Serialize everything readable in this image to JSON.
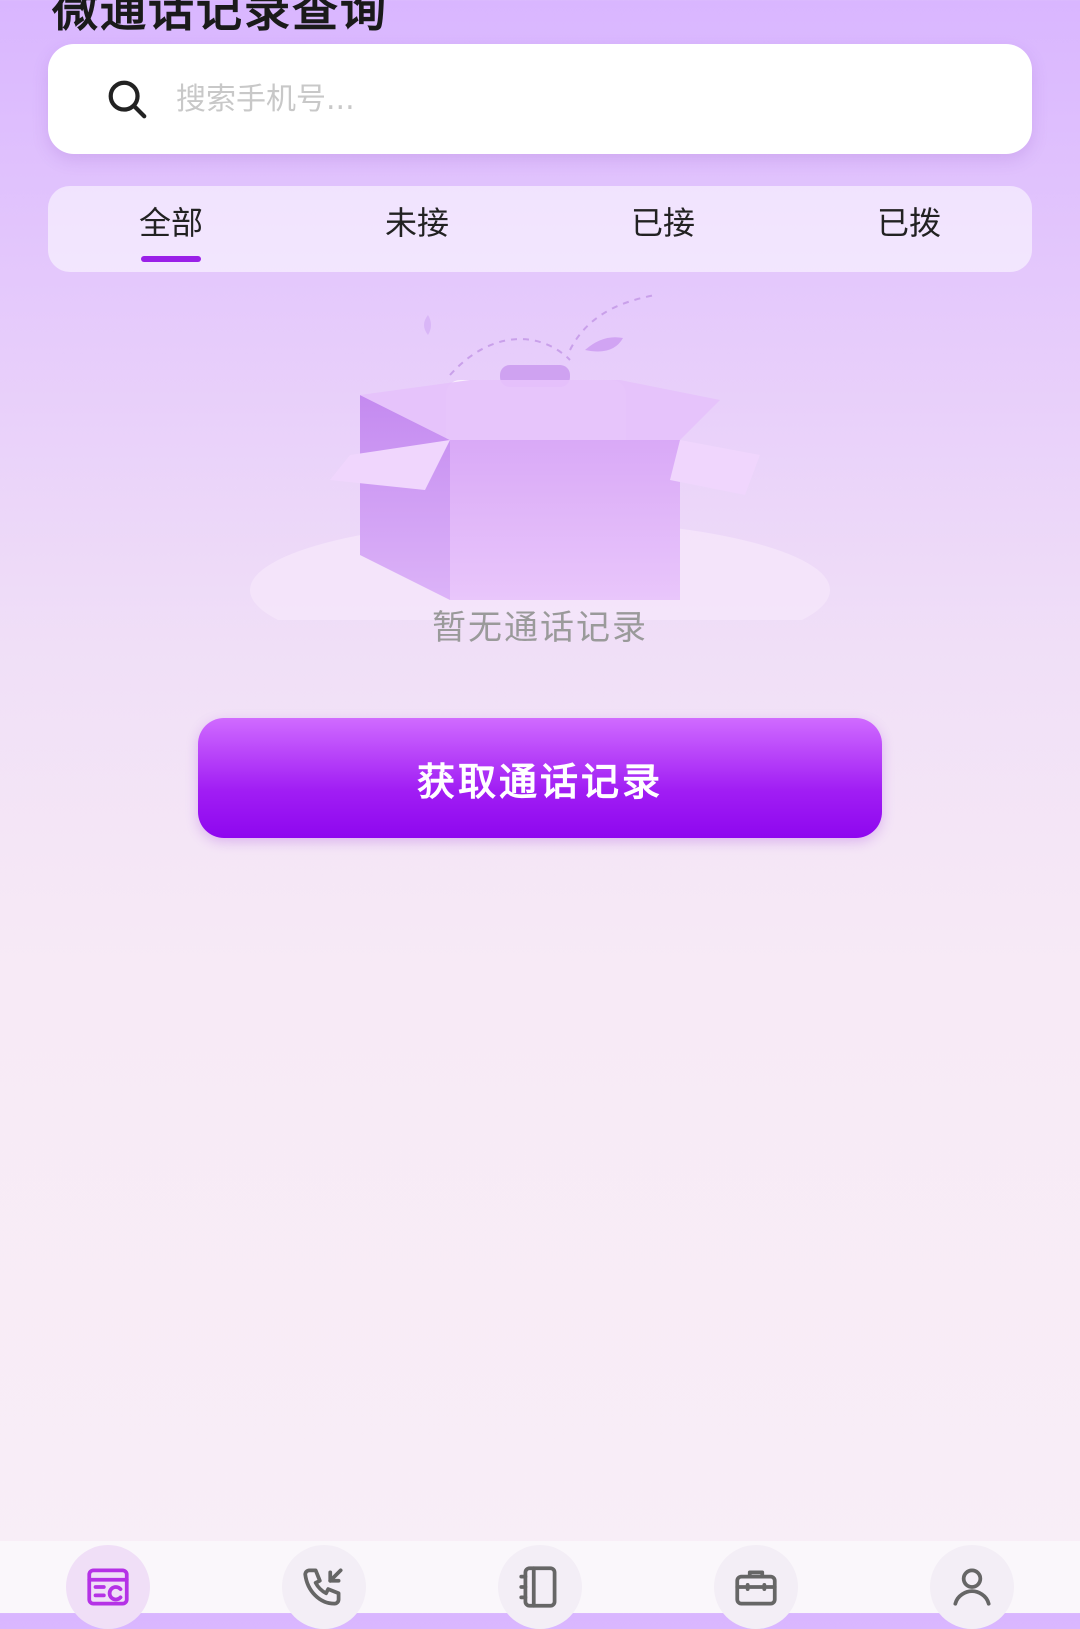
{
  "app": {
    "title": "微通话记录查询",
    "top_right_action": "···"
  },
  "search": {
    "placeholder": "搜索手机号..."
  },
  "tabs": [
    {
      "label": "全部",
      "active": true
    },
    {
      "label": "未接",
      "active": false
    },
    {
      "label": "已接",
      "active": false
    },
    {
      "label": "已拨",
      "active": false
    }
  ],
  "empty_state": {
    "message": "暂无通话记录"
  },
  "primary_action": {
    "label": "获取通话记录"
  },
  "bottom_nav": [
    {
      "icon": "call-log-icon",
      "active": true
    },
    {
      "icon": "incoming-call-icon",
      "active": false
    },
    {
      "icon": "contacts-book-icon",
      "active": false
    },
    {
      "icon": "briefcase-icon",
      "active": false
    },
    {
      "icon": "user-profile-icon",
      "active": false
    }
  ],
  "colors": {
    "accent": "#9a20e8",
    "button_top": "#d06bff",
    "button_bottom": "#8e07ef",
    "nav_active": "#b532e6"
  }
}
